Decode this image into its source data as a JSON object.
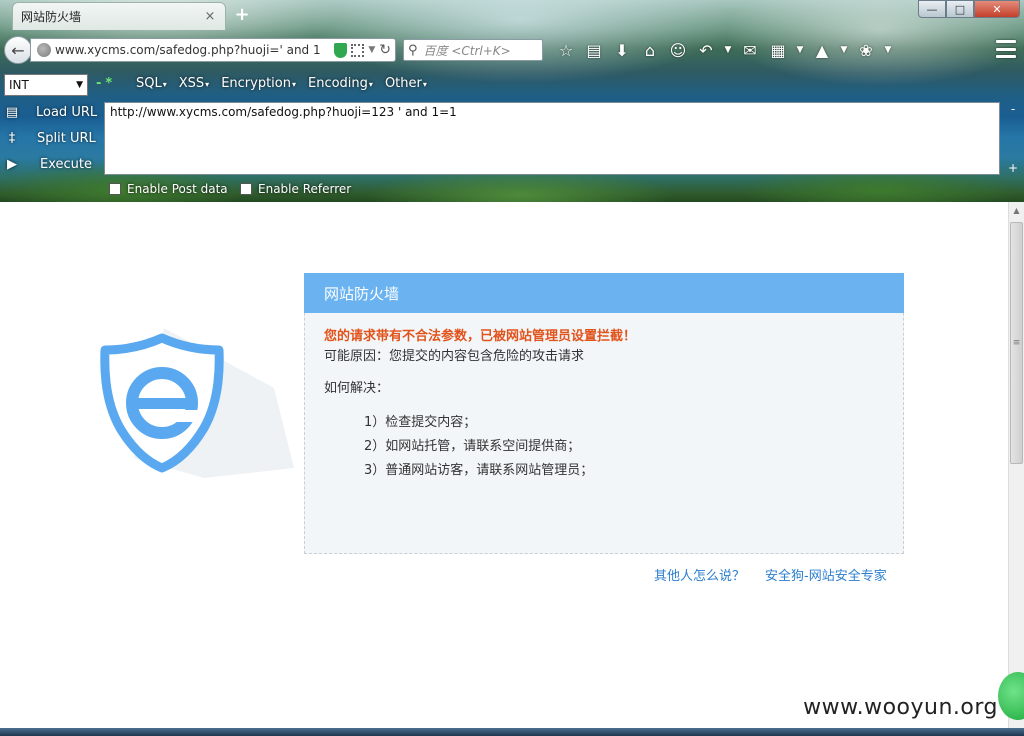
{
  "browser": {
    "tab_title": "网站防火墙",
    "tab_close": "×",
    "new_tab": "+",
    "url": "www.xycms.com/safedog.php?huoji=' and 1",
    "search_placeholder": "百度 <Ctrl+K>",
    "window_controls": {
      "minimize": "—",
      "maximize": "□",
      "close": "✕"
    }
  },
  "hackbar": {
    "select_value": "INT",
    "menu": [
      "SQL",
      "XSS",
      "Encryption",
      "Encoding",
      "Other"
    ],
    "actions": {
      "load": "Load URL",
      "split": "Split URL",
      "execute": "Execute"
    },
    "textarea_value": "http://www.xycms.com/safedog.php?huoji=123 ' and 1=1",
    "checkbox_post": "Enable Post data",
    "checkbox_referrer": "Enable Referrer"
  },
  "page": {
    "panel_title": "网站防火墙",
    "warning": "您的请求带有不合法参数，已被网站管理员设置拦截！",
    "reason": "可能原因：您提交的内容包含危险的攻击请求",
    "how_to": "如何解决：",
    "steps": [
      "1）检查提交内容；",
      "2）如网站托管，请联系空间提供商；",
      "3）普通网站访客，请联系网站管理员；"
    ],
    "link_others": "其他人怎么说？",
    "link_safedog": "安全狗-网站安全专家",
    "watermark": "www.wooyun.org"
  },
  "colors": {
    "panel_header": "#6ab3f0",
    "warning": "#e2531c",
    "link": "#2b7fcf",
    "logo_blue": "#5aa9f0"
  }
}
